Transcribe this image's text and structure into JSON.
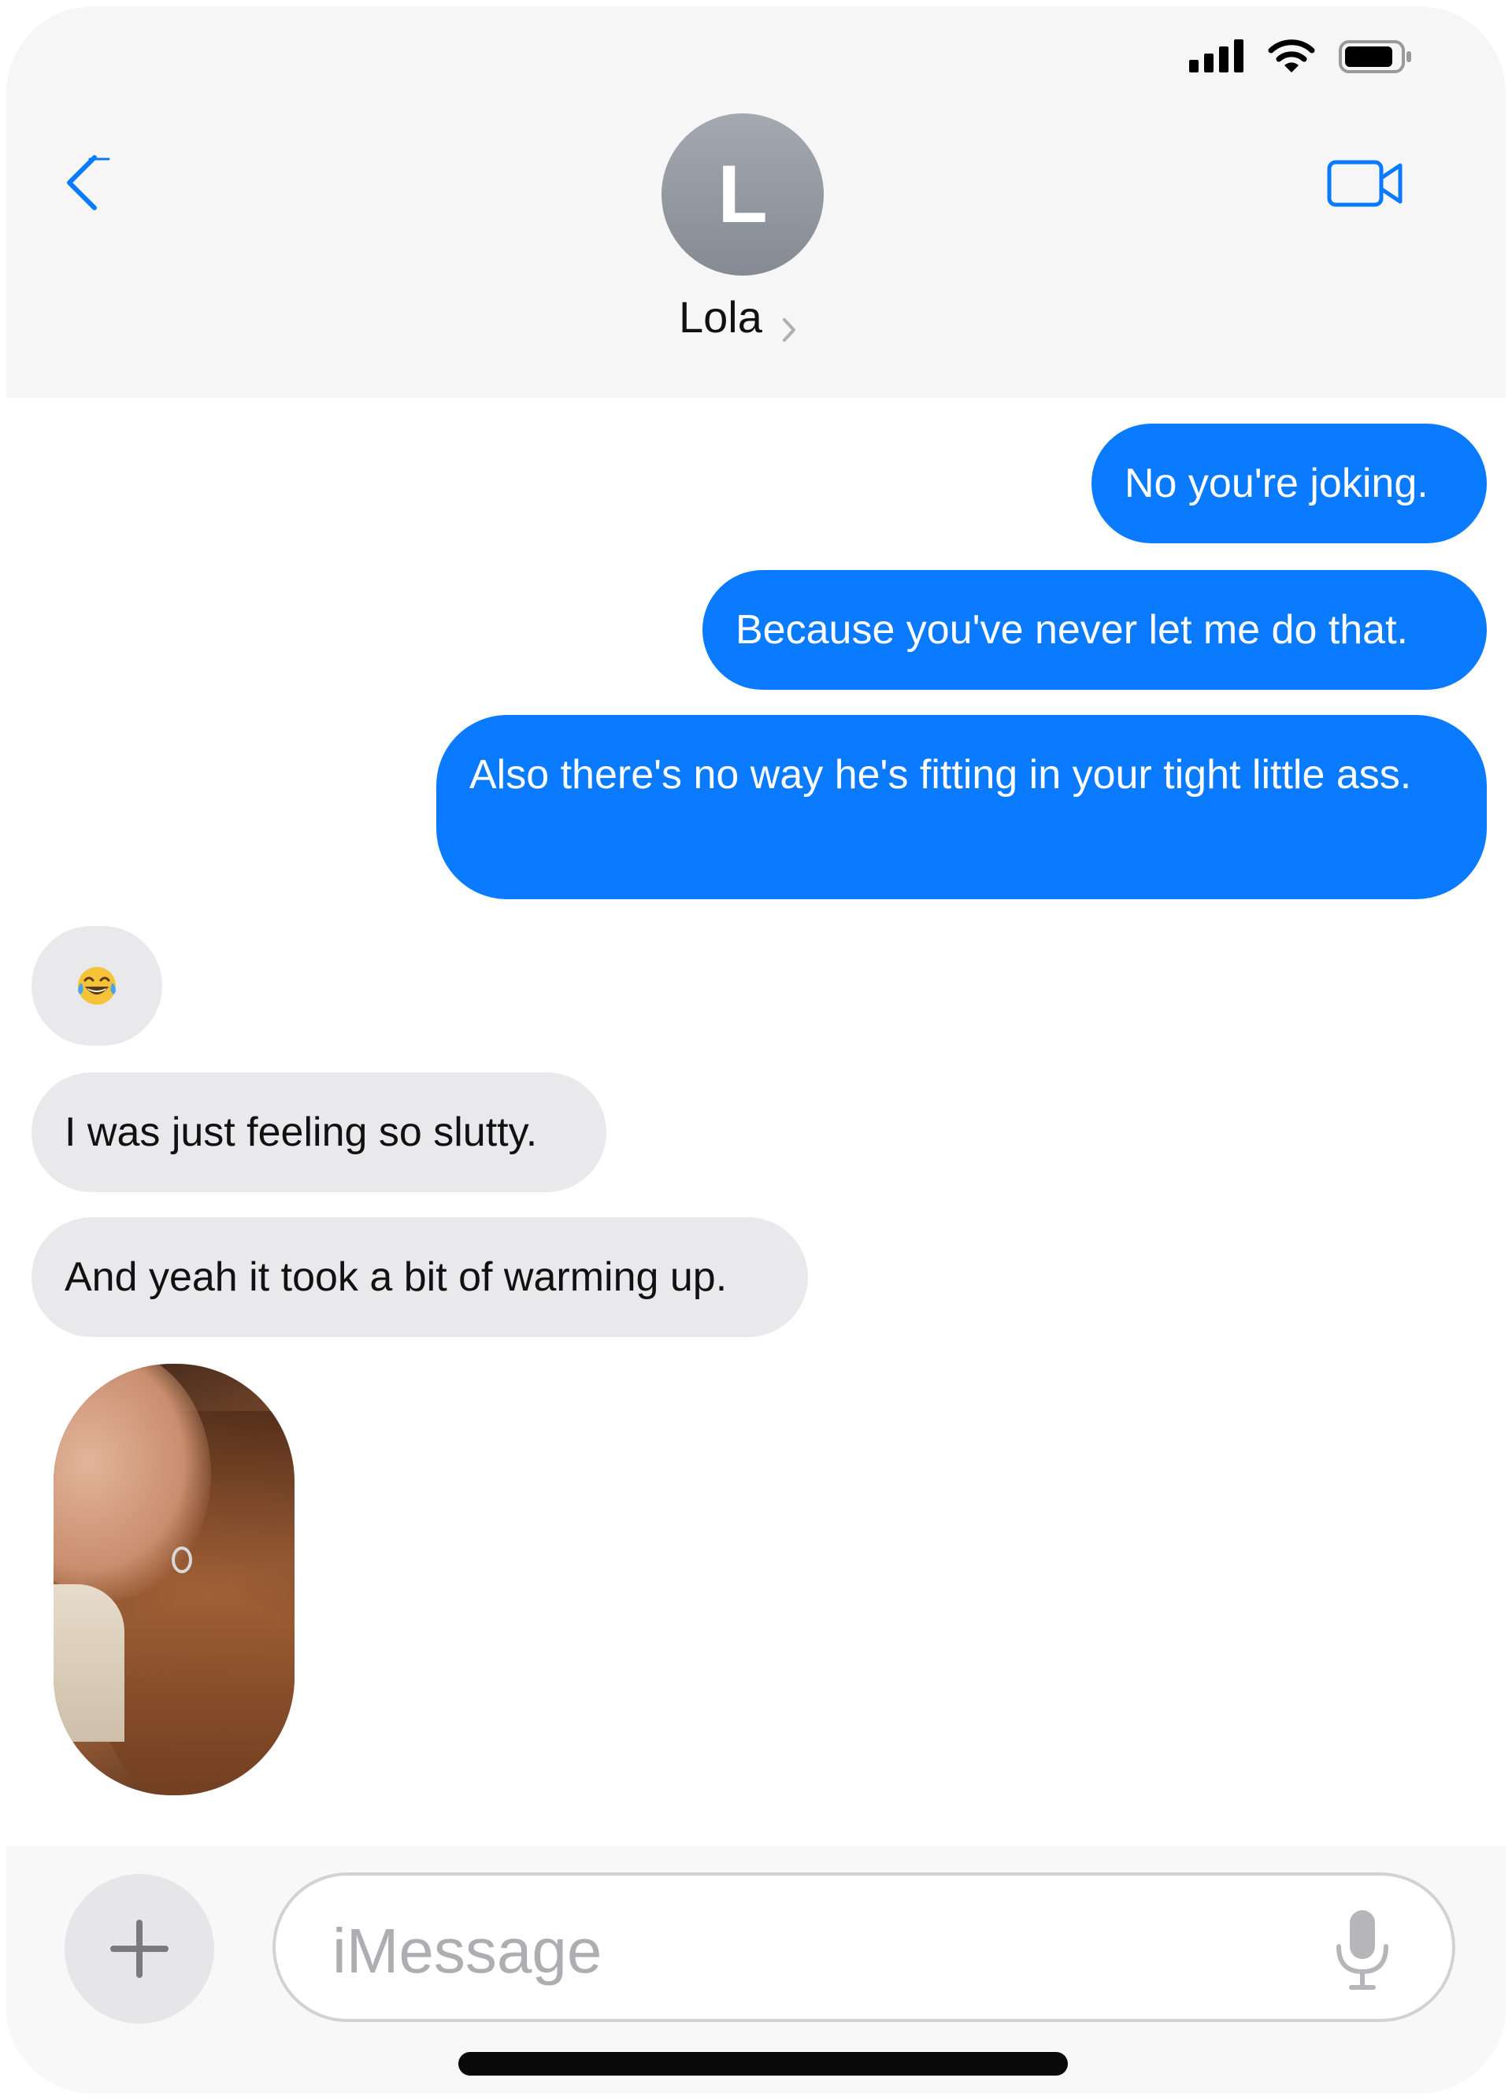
{
  "header": {
    "avatar_initial": "L",
    "contact_name": "Lola"
  },
  "icons": {
    "back": "chevron-left-icon",
    "video": "video-camera-icon",
    "signal": "cellular-signal-icon",
    "wifi": "wifi-icon",
    "battery": "battery-icon",
    "add": "plus-icon",
    "mic": "microphone-icon"
  },
  "colors": {
    "sent_bubble": "#0a7aff",
    "received_bubble": "#e9e9eb",
    "accent": "#0a7aff"
  },
  "messages": [
    {
      "direction": "sent",
      "text": "No you're joking."
    },
    {
      "direction": "sent",
      "text": "Because you've never let me do that."
    },
    {
      "direction": "sent",
      "text": "Also there's no way he's fitting in your tight little ass."
    },
    {
      "direction": "received",
      "text": "😂"
    },
    {
      "direction": "received",
      "text": "I was just feeling so slutty."
    },
    {
      "direction": "received",
      "text": "And yeah it took a bit of warming up."
    },
    {
      "direction": "received",
      "type": "image"
    }
  ],
  "composer": {
    "placeholder": "iMessage",
    "value": ""
  }
}
